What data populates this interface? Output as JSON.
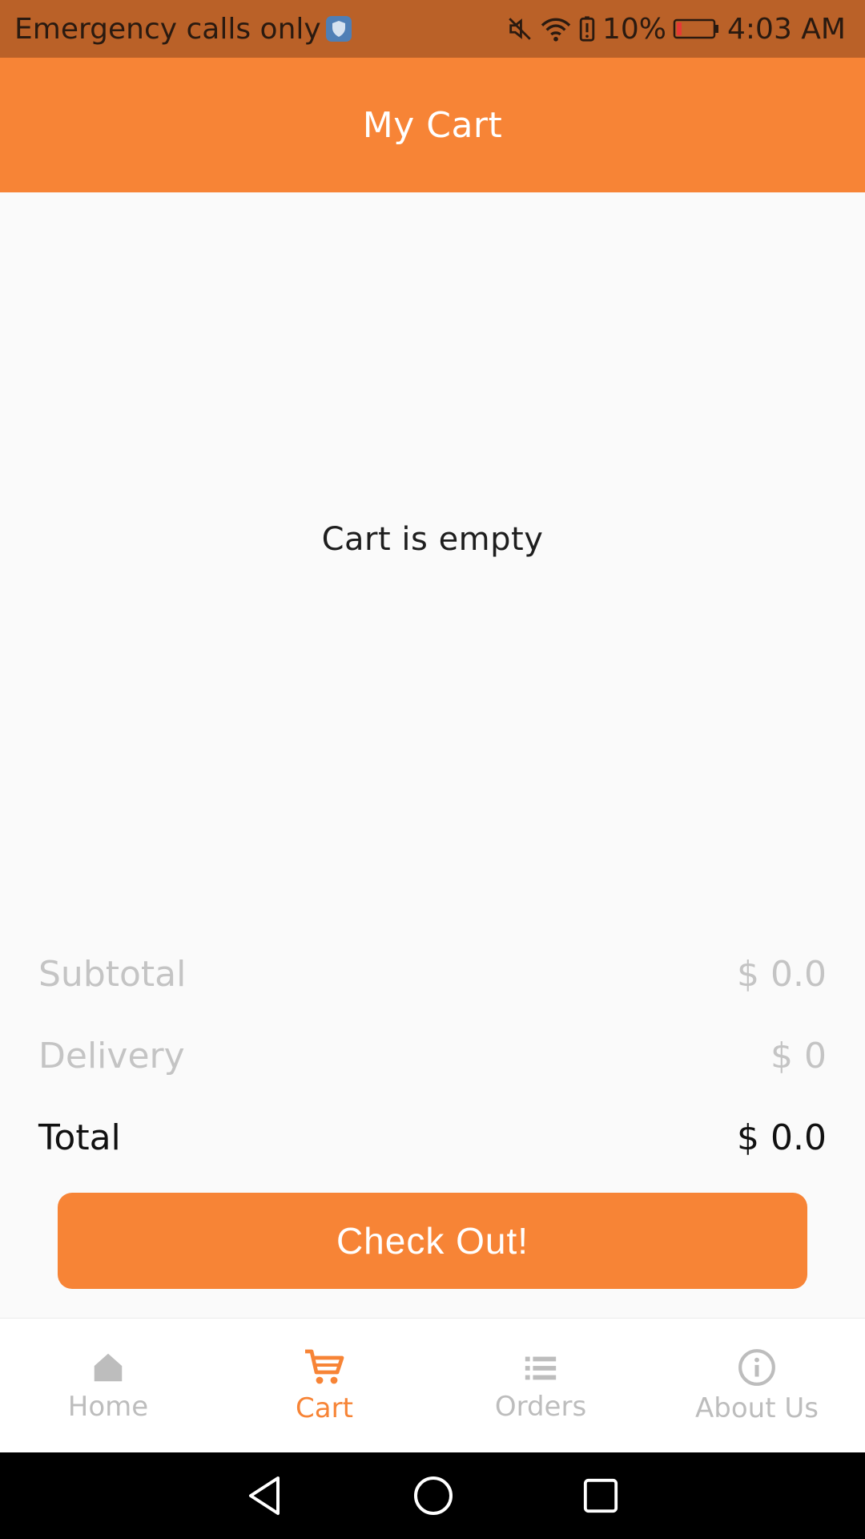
{
  "status_bar": {
    "carrier_text": "Emergency calls only",
    "battery_percent": "10%",
    "time": "4:03 AM",
    "icons": [
      "shield-icon",
      "mute-icon",
      "wifi-icon",
      "battery-alert-icon",
      "battery-icon"
    ]
  },
  "app_bar": {
    "title": "My Cart"
  },
  "main": {
    "empty_message": "Cart is empty"
  },
  "summary": {
    "subtotal_label": "Subtotal",
    "subtotal_value": "$ 0.0",
    "delivery_label": "Delivery",
    "delivery_value": "$ 0",
    "total_label": "Total",
    "total_value": "$ 0.0"
  },
  "checkout_button": {
    "label": "Check Out!"
  },
  "bottom_nav": {
    "items": [
      {
        "label": "Home",
        "icon": "home-icon"
      },
      {
        "label": "Cart",
        "icon": "cart-icon",
        "active": true
      },
      {
        "label": "Orders",
        "icon": "list-icon"
      },
      {
        "label": "About Us",
        "icon": "info-icon"
      }
    ]
  },
  "system_nav": {
    "buttons": [
      "back-icon",
      "home-circle-icon",
      "recents-icon"
    ]
  },
  "colors": {
    "accent": "#f78436",
    "status_bar": "#ba6128",
    "muted_text": "#c4c4c4",
    "inactive_nav": "#bdbdbd"
  }
}
